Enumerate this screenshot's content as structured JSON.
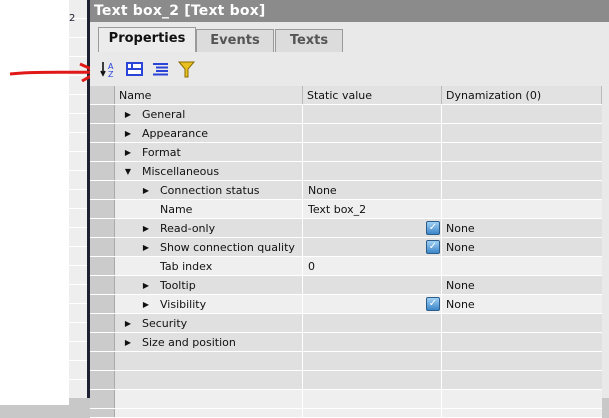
{
  "side_number": "2",
  "title": "Text box_2 [Text box]",
  "tabs": [
    "Properties",
    "Events",
    "Texts"
  ],
  "toolbar": [
    "sort-az-icon",
    "categorized-view-icon",
    "list-view-icon",
    "filter-icon"
  ],
  "columns": [
    "Name",
    "Static value",
    "Dynamization (0)"
  ],
  "rows": [
    {
      "name": "General",
      "level": 0,
      "expander": "collapsed",
      "static": "",
      "checked": false,
      "dyn": ""
    },
    {
      "name": "Appearance",
      "level": 0,
      "expander": "collapsed",
      "static": "",
      "checked": false,
      "dyn": ""
    },
    {
      "name": "Format",
      "level": 0,
      "expander": "collapsed",
      "static": "",
      "checked": false,
      "dyn": ""
    },
    {
      "name": "Miscellaneous",
      "level": 0,
      "expander": "expanded",
      "static": "",
      "checked": false,
      "dyn": ""
    },
    {
      "name": "Connection status",
      "level": 1,
      "expander": "collapsed",
      "static": "None",
      "checked": false,
      "dyn": ""
    },
    {
      "name": "Name",
      "level": 1,
      "expander": "",
      "static": "Text box_2",
      "checked": false,
      "dyn": ""
    },
    {
      "name": "Read-only",
      "level": 1,
      "expander": "collapsed",
      "static": "",
      "checked": true,
      "dyn": "None"
    },
    {
      "name": "Show connection quality",
      "level": 1,
      "expander": "collapsed",
      "static": "",
      "checked": true,
      "dyn": "None"
    },
    {
      "name": "Tab index",
      "level": 1,
      "expander": "",
      "static": "0",
      "checked": false,
      "dyn": ""
    },
    {
      "name": "Tooltip",
      "level": 1,
      "expander": "collapsed",
      "static": "",
      "checked": false,
      "dyn": "None"
    },
    {
      "name": "Visibility",
      "level": 1,
      "expander": "collapsed",
      "static": "",
      "checked": true,
      "dyn": "None"
    },
    {
      "name": "Security",
      "level": 0,
      "expander": "collapsed",
      "static": "",
      "checked": false,
      "dyn": ""
    },
    {
      "name": "Size and position",
      "level": 0,
      "expander": "collapsed",
      "static": "",
      "checked": false,
      "dyn": ""
    }
  ]
}
